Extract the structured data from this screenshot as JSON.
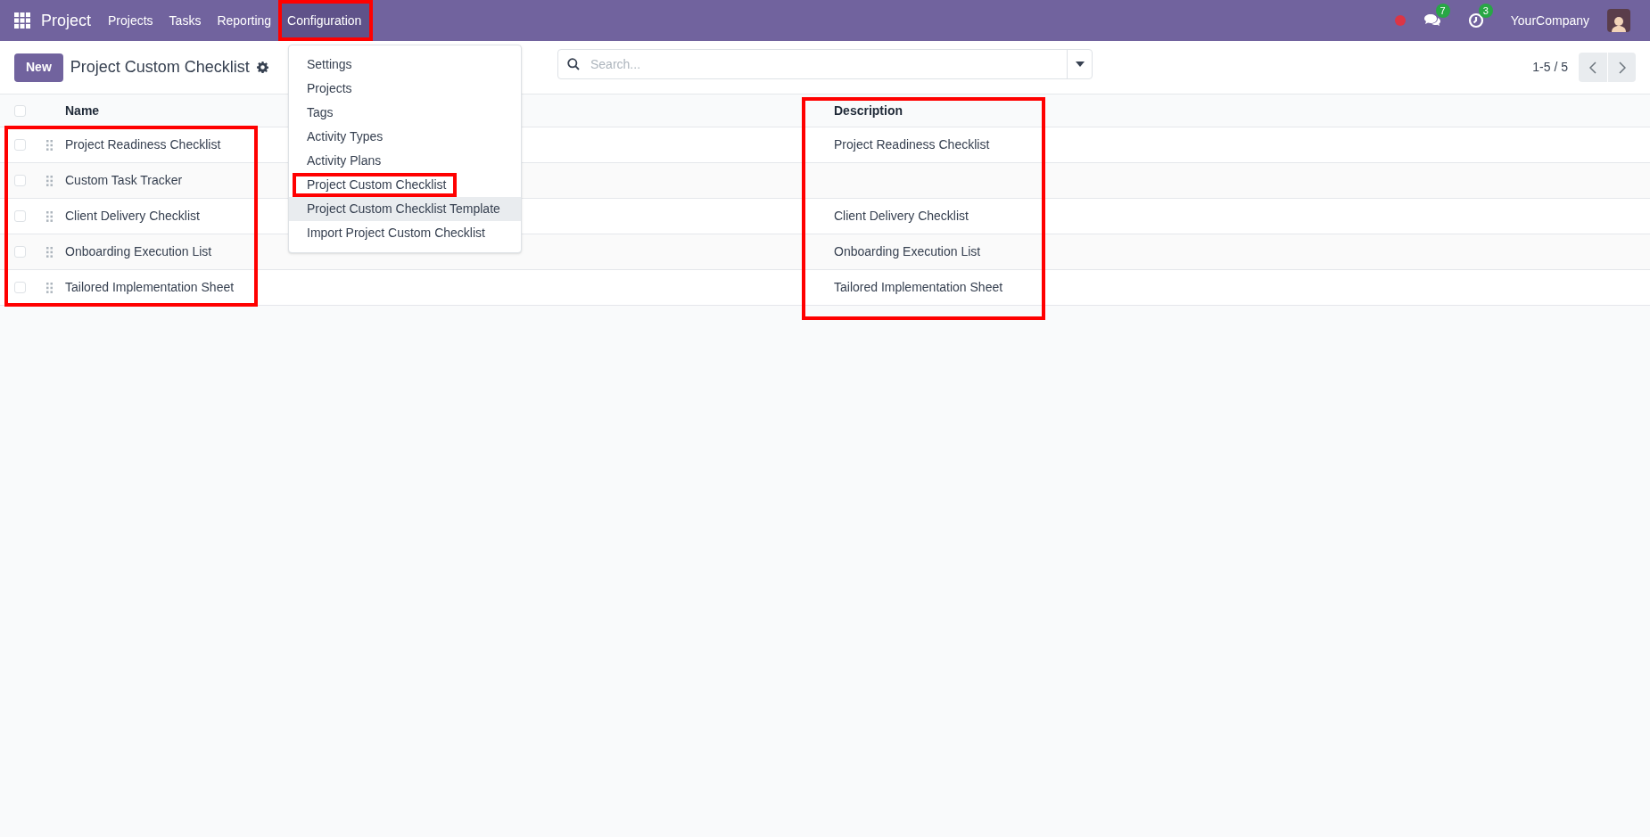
{
  "navbar": {
    "app_name": "Project",
    "menus": [
      {
        "label": "Projects",
        "open": false
      },
      {
        "label": "Tasks",
        "open": false
      },
      {
        "label": "Reporting",
        "open": false
      },
      {
        "label": "Configuration",
        "open": true
      }
    ],
    "messages_count": "7",
    "activities_count": "3",
    "company": "YourCompany"
  },
  "dropdown": {
    "items": [
      {
        "label": "Settings",
        "hovered": false,
        "outlined": false
      },
      {
        "label": "Projects",
        "hovered": false,
        "outlined": false
      },
      {
        "label": "Tags",
        "hovered": false,
        "outlined": false
      },
      {
        "label": "Activity Types",
        "hovered": false,
        "outlined": false
      },
      {
        "label": "Activity Plans",
        "hovered": false,
        "outlined": false
      },
      {
        "label": "Project Custom Checklist",
        "hovered": false,
        "outlined": true
      },
      {
        "label": "Project Custom Checklist Template",
        "hovered": true,
        "outlined": false
      },
      {
        "label": "Import Project Custom Checklist",
        "hovered": false,
        "outlined": false
      }
    ]
  },
  "control_panel": {
    "new_button": "New",
    "title": "Project Custom Checklist",
    "search": {
      "placeholder": "Search..."
    },
    "pager": "1-5 / 5"
  },
  "table": {
    "all_checked": false,
    "columns": [
      "Name",
      "Description"
    ],
    "rows": [
      {
        "checked": false,
        "name": "Project Readiness Checklist",
        "description": "Project Readiness Checklist"
      },
      {
        "checked": false,
        "name": "Custom Task Tracker"
      },
      {
        "checked": false,
        "name": "Client Delivery Checklist",
        "description": "Client Delivery Checklist"
      },
      {
        "checked": false,
        "name": "Onboarding Execution List",
        "description": "Onboarding Execution List"
      },
      {
        "checked": false,
        "name": "Tailored Implementation Sheet",
        "description": "Tailored Implementation Sheet"
      }
    ]
  }
}
